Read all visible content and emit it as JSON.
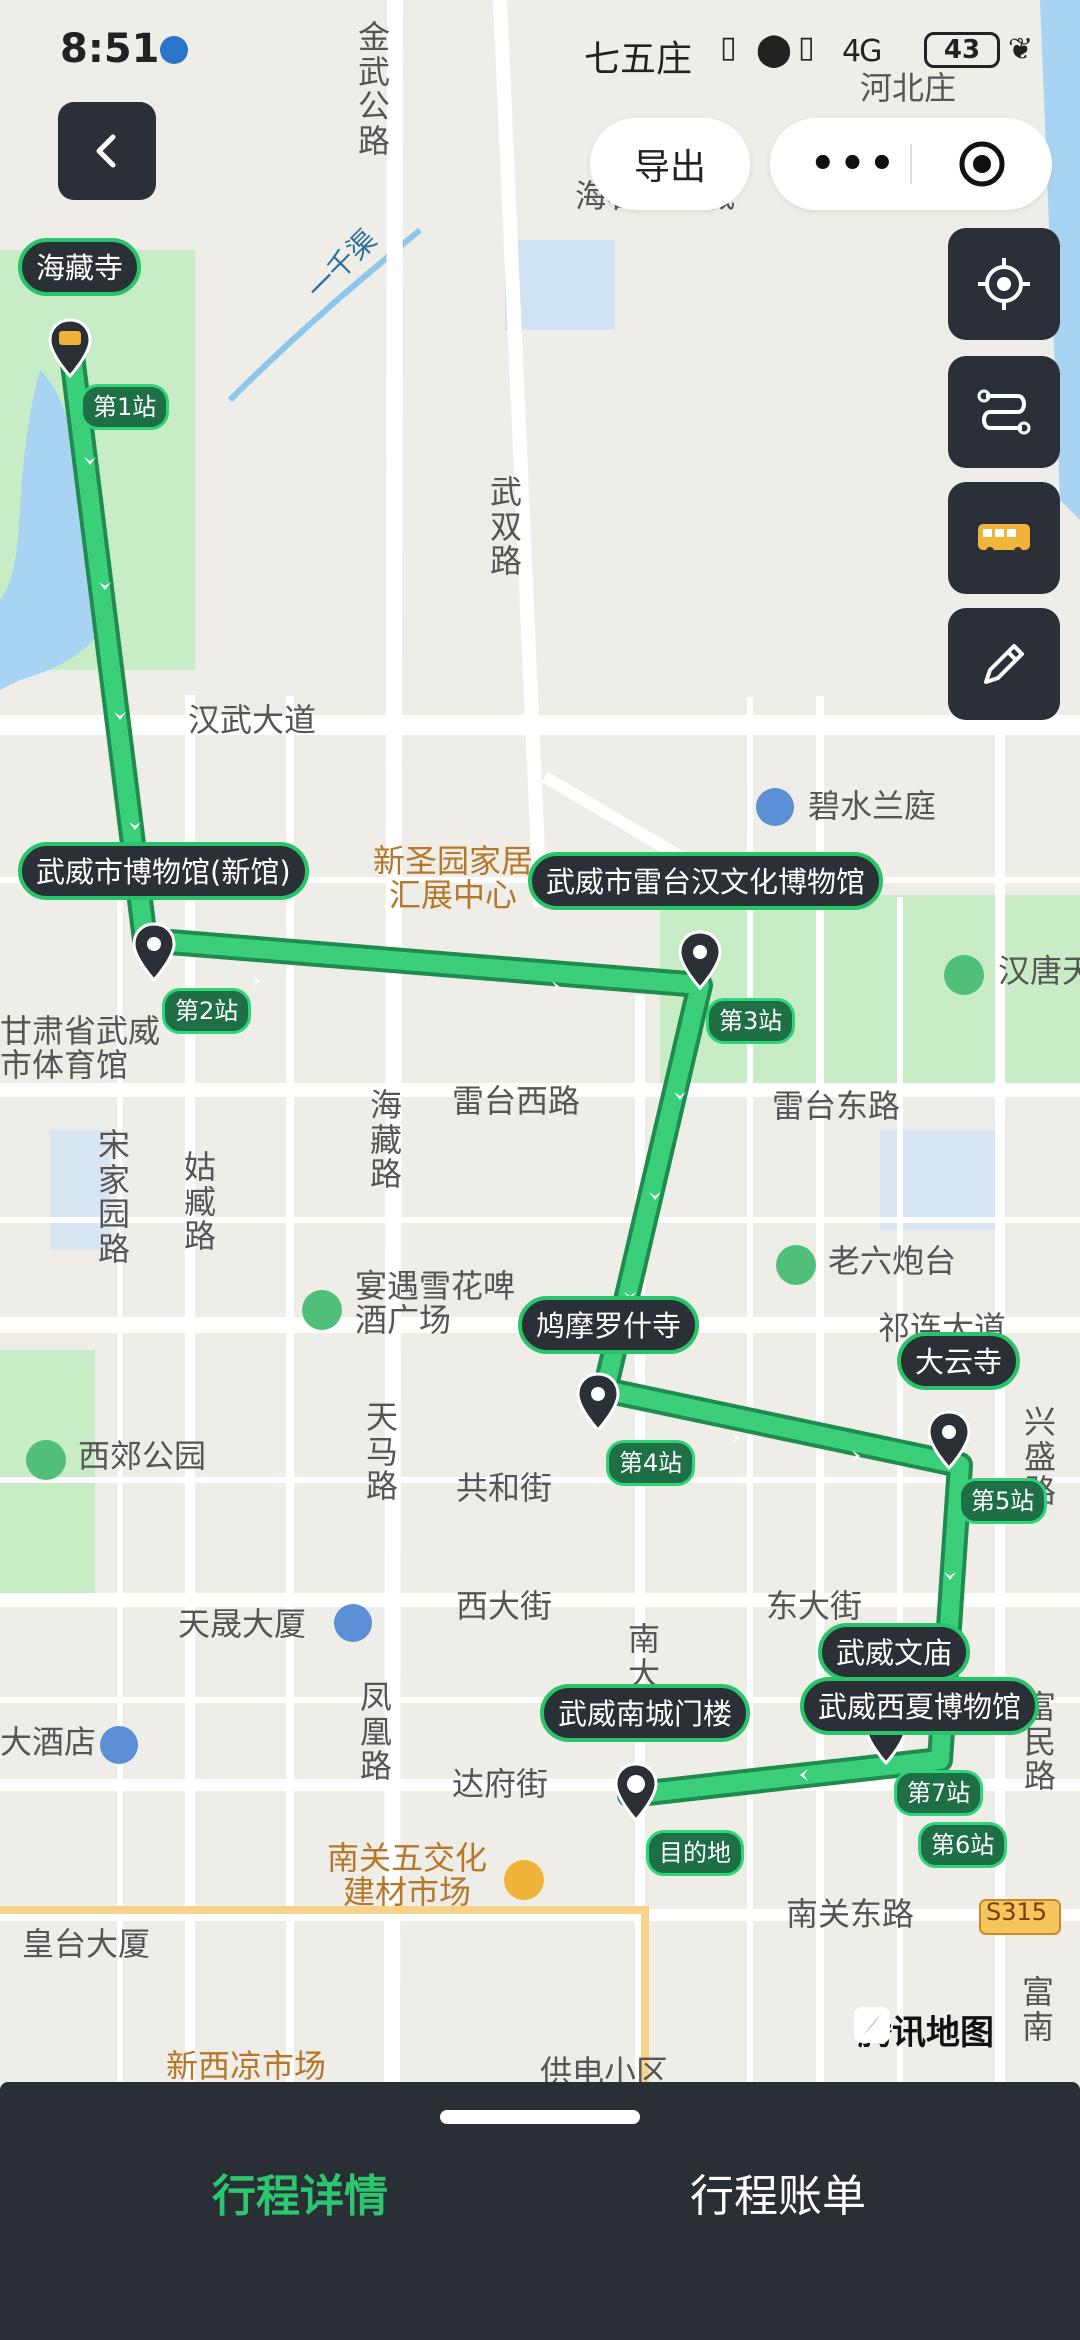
{
  "status_bar": {
    "time": "8:51",
    "carrier_label": "七五庄",
    "network": "4G",
    "battery": "43"
  },
  "header": {
    "export_label": "导出",
    "more_label": "•••"
  },
  "map": {
    "labels": {
      "hebeizhuang": "河北庄",
      "haiyi_chongqing": "海石重庆城",
      "ganqu": "一千渠",
      "jinwu_road": "金武公路",
      "wushuang_road": "武双路",
      "hanwu_avenue": "汉武大道",
      "bishui_lanting": "碧水兰庭",
      "xinshengyuan": "新圣园家居汇展中心",
      "gansu_sports": "甘肃省武威市体育馆",
      "leitai_west": "雷台西路",
      "leitai_east": "雷台东路",
      "hanwang": "汉唐天",
      "songjiayuan_road": "宋家园路",
      "guzang_road": "姑臧路",
      "haizang_road": "海藏路",
      "yanyu_xuehua": "宴遇雪花啤酒广场",
      "laoliu_paotai": "老六炮台",
      "zuci_avenue": "祁连大道",
      "xijiao_park": "西郊公园",
      "tianma_road": "天马路",
      "gonghe_street": "共和街",
      "xingsheng_road": "兴盛路",
      "tiancheng_tower": "天晟大厦",
      "xi_street": "西大街",
      "dong_street": "东大街",
      "nan_street": "南大街",
      "fenghuang_road": "凤凰路",
      "dafu_street": "达府街",
      "fumin_road": "富民路",
      "hotel": "大酒店",
      "nanguan_wujiao": "南关五交化建材市场",
      "huangtai_tower": "皇台大厦",
      "nanguan_east": "南关东路",
      "s315": "S315",
      "xinxiliang_market": "新西凉市场",
      "gongdian_xiaoqu": "供电小区",
      "funan": "富南"
    },
    "stops": [
      {
        "name": "海藏寺"
      },
      {
        "name": "武威市博物馆(新馆)"
      },
      {
        "name": "武威市雷台汉文化博物馆"
      },
      {
        "name": "鸠摩罗什寺"
      },
      {
        "name": "大云寺"
      },
      {
        "name": "武威文庙"
      },
      {
        "name": "武威西夏博物馆"
      },
      {
        "name": "武威南城门楼"
      }
    ],
    "stop_tags": [
      "第1站",
      "第2站",
      "第3站",
      "第4站",
      "第5站",
      "第6站",
      "第7站",
      "目的地"
    ],
    "brand": "腾讯地图",
    "route_color": "#3ccf7a"
  },
  "tabs": [
    {
      "label": "行程详情",
      "active": true
    },
    {
      "label": "行程账单",
      "active": false
    }
  ]
}
